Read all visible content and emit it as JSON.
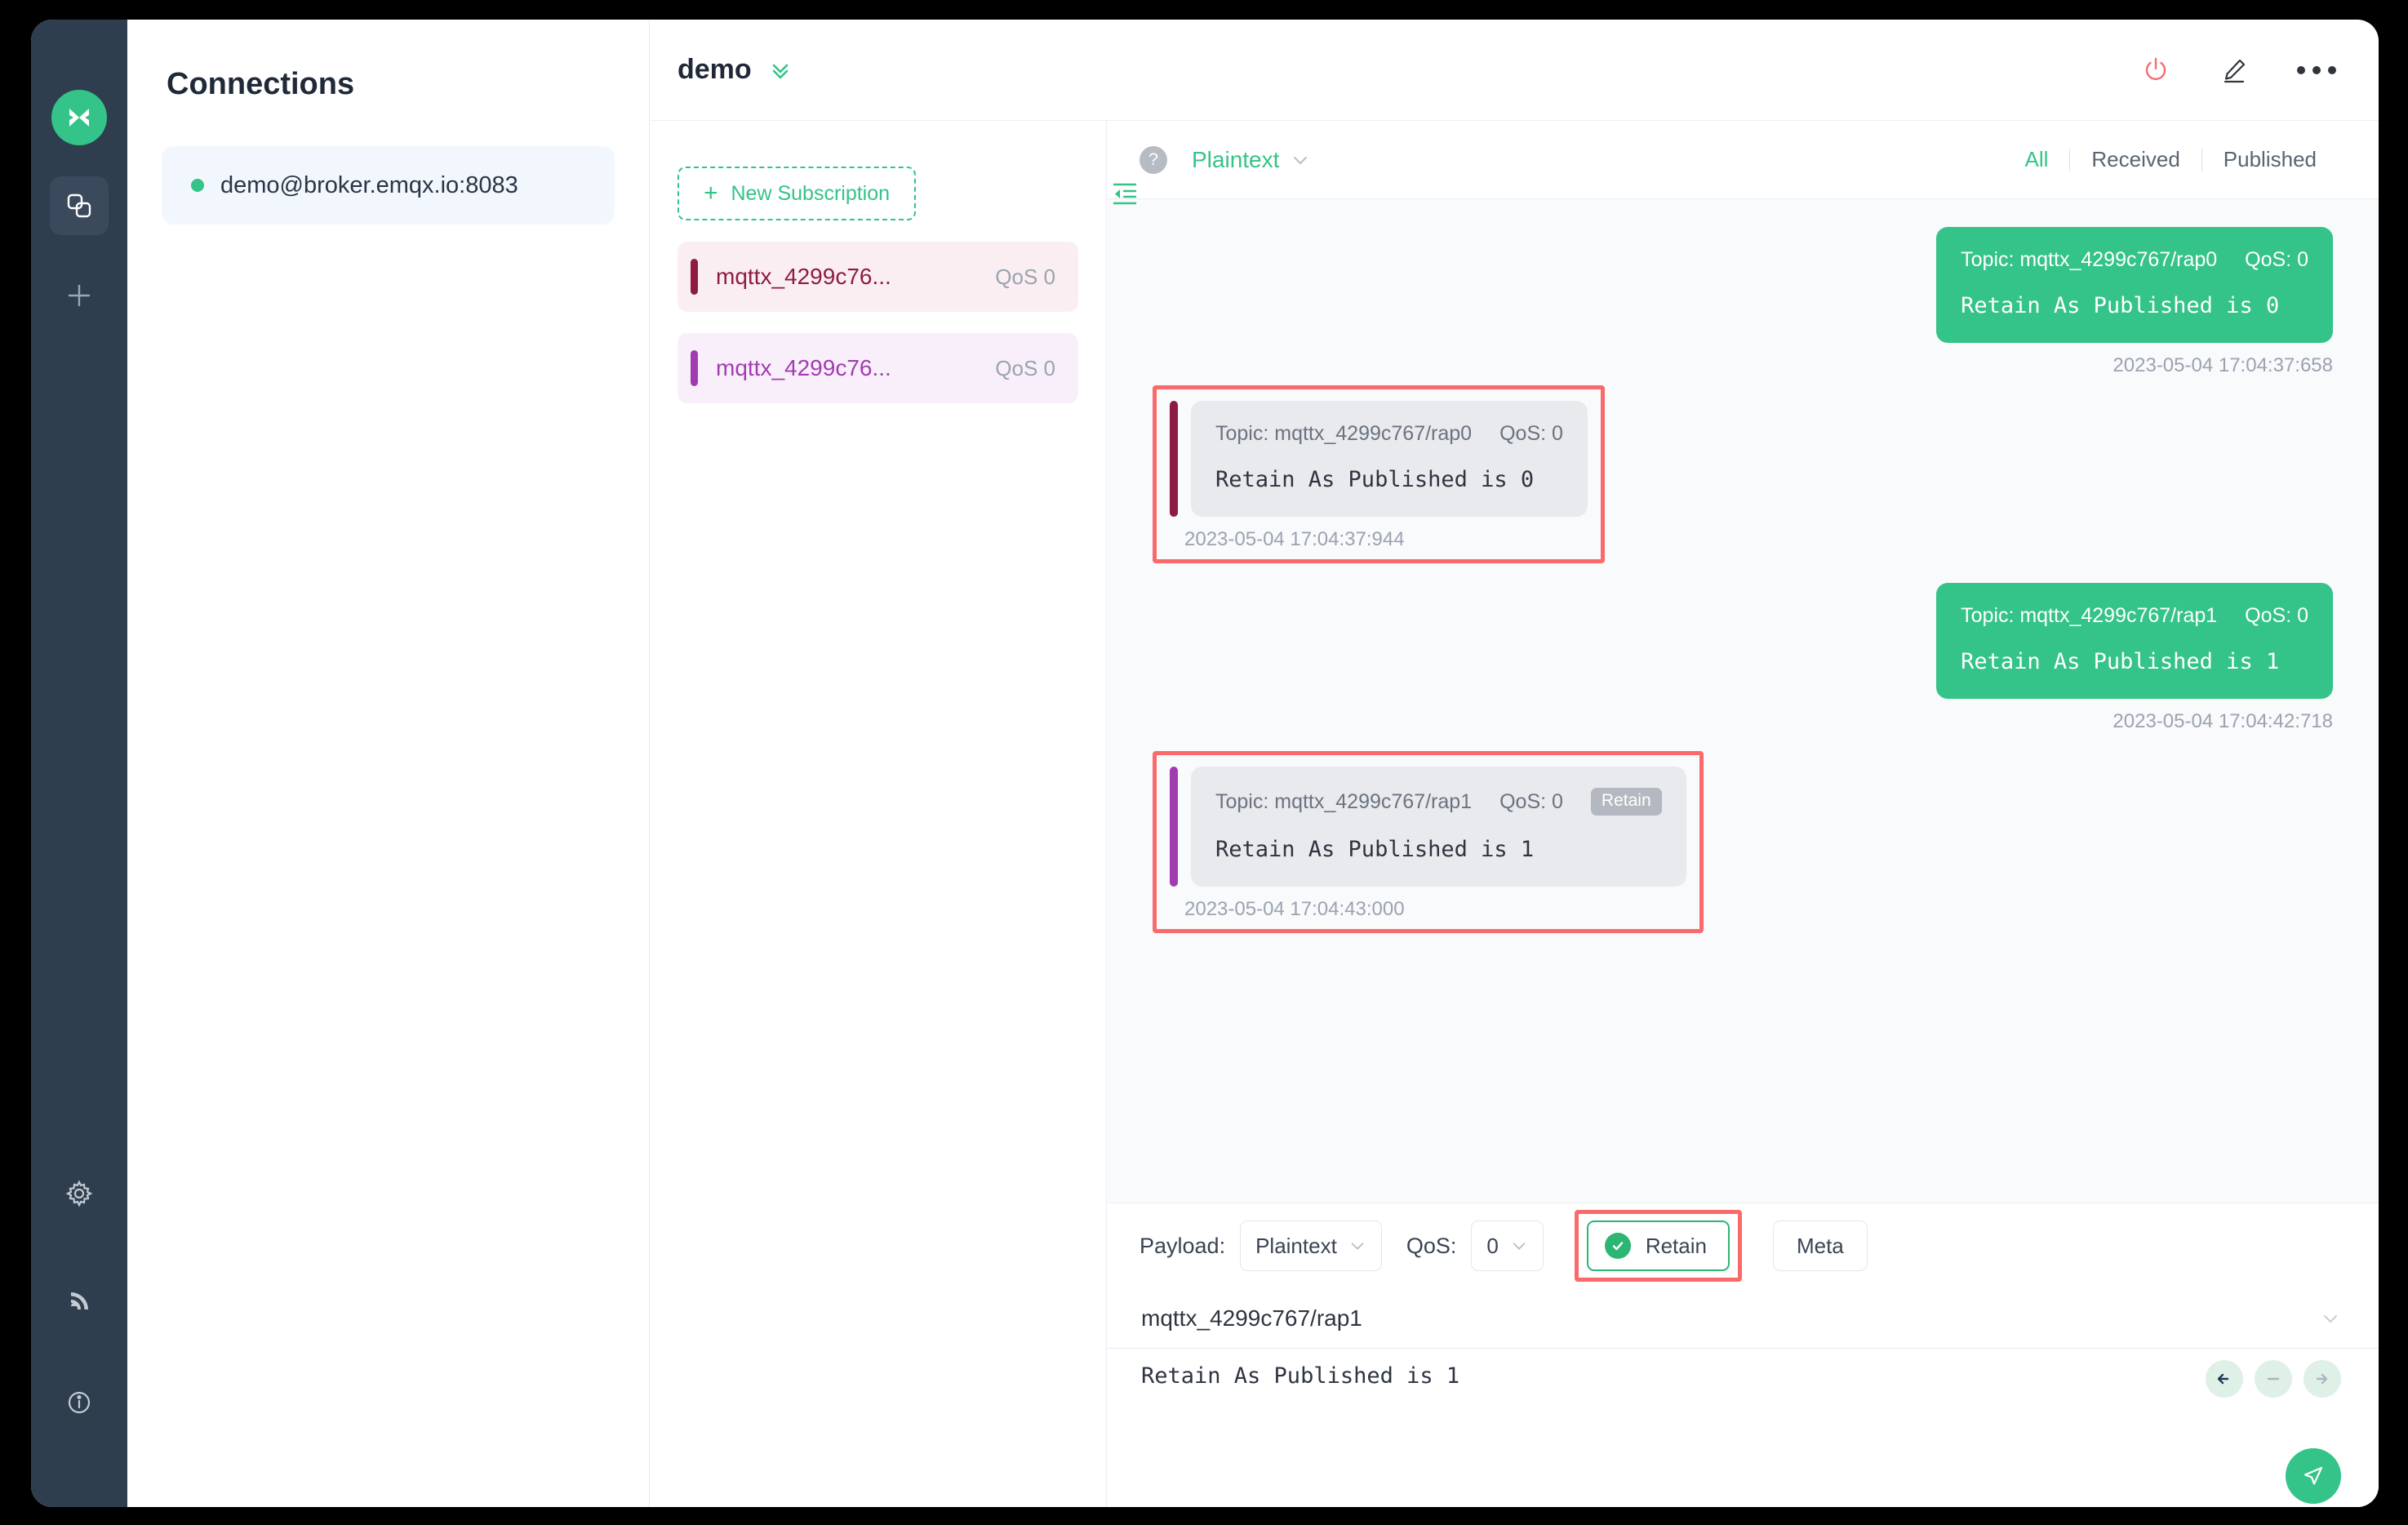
{
  "rail": {
    "logo_icon": "mqttx-logo-icon",
    "items": [
      {
        "name": "connections-icon",
        "active": true
      },
      {
        "name": "add-connection-icon",
        "active": false
      }
    ],
    "bottom_items": [
      {
        "name": "settings-gear-icon"
      },
      {
        "name": "broadcast-signal-icon"
      },
      {
        "name": "info-circle-icon"
      }
    ]
  },
  "connections": {
    "title": "Connections",
    "items": [
      {
        "label": "demo@broker.emqx.io:8083",
        "status": "connected",
        "status_color": "#34c388"
      }
    ]
  },
  "topbar": {
    "title": "demo",
    "chevron_icon": "double-chevron-down-icon",
    "actions": [
      {
        "name": "power-icon",
        "color": "#f56c6c"
      },
      {
        "name": "edit-pencil-icon",
        "color": "#30353c"
      },
      {
        "name": "more-options-icon",
        "color": "#30353c"
      }
    ]
  },
  "subscriptions": {
    "new_subscription_label": "New Subscription",
    "collapse_icon": "collapse-panel-icon",
    "items": [
      {
        "topic": "mqttx_4299c76...",
        "qos": "QoS 0",
        "accent": "#8e1b44",
        "bg": "#fbeef3"
      },
      {
        "topic": "mqttx_4299c76...",
        "qos": "QoS 0",
        "accent": "#a13cb0",
        "bg": "#f9effa"
      }
    ]
  },
  "messages_toolbar": {
    "help_icon": "help-question-icon",
    "format": "Plaintext",
    "format_chevron_icon": "chevron-down-icon",
    "filters": [
      {
        "label": "All",
        "active": true
      },
      {
        "label": "Received",
        "active": false
      },
      {
        "label": "Published",
        "active": false
      }
    ]
  },
  "messages": [
    {
      "direction": "published",
      "topic_label": "Topic: mqttx_4299c767/rap0",
      "qos_label": "QoS: 0",
      "retain": false,
      "payload": "Retain As Published is 0",
      "time": "2023-05-04 17:04:37:658",
      "highlighted": false
    },
    {
      "direction": "received",
      "topic_label": "Topic: mqttx_4299c767/rap0",
      "qos_label": "QoS: 0",
      "retain": false,
      "payload": "Retain As Published is 0",
      "time": "2023-05-04 17:04:37:944",
      "accent": "#8e1b44",
      "highlighted": true
    },
    {
      "direction": "published",
      "topic_label": "Topic: mqttx_4299c767/rap1",
      "qos_label": "QoS: 0",
      "retain": false,
      "payload": "Retain As Published is 1",
      "time": "2023-05-04 17:04:42:718",
      "highlighted": false
    },
    {
      "direction": "received",
      "topic_label": "Topic: mqttx_4299c767/rap1",
      "qos_label": "QoS: 0",
      "retain": true,
      "retain_badge_label": "Retain",
      "payload": "Retain As Published is 1",
      "time": "2023-05-04 17:04:43:000",
      "accent": "#a13cb0",
      "highlighted": true
    }
  ],
  "publish": {
    "payload_label": "Payload:",
    "payload_format": "Plaintext",
    "qos_label": "QoS:",
    "qos_value": "0",
    "retain_label": "Retain",
    "retain_active": true,
    "meta_label": "Meta",
    "topic": "mqttx_4299c767/rap1",
    "editor_value": "Retain As Published is 1",
    "nav_buttons": [
      {
        "name": "previous-arrow-icon",
        "enabled": true
      },
      {
        "name": "minus-icon",
        "enabled": false
      },
      {
        "name": "next-arrow-icon",
        "enabled": false
      }
    ],
    "send_icon": "send-paper-plane-icon"
  },
  "colors": {
    "brand_green": "#34c388",
    "highlight_red": "#fa6a6a",
    "rail_bg": "#2f3e4f",
    "power_red": "#f56c6c"
  }
}
